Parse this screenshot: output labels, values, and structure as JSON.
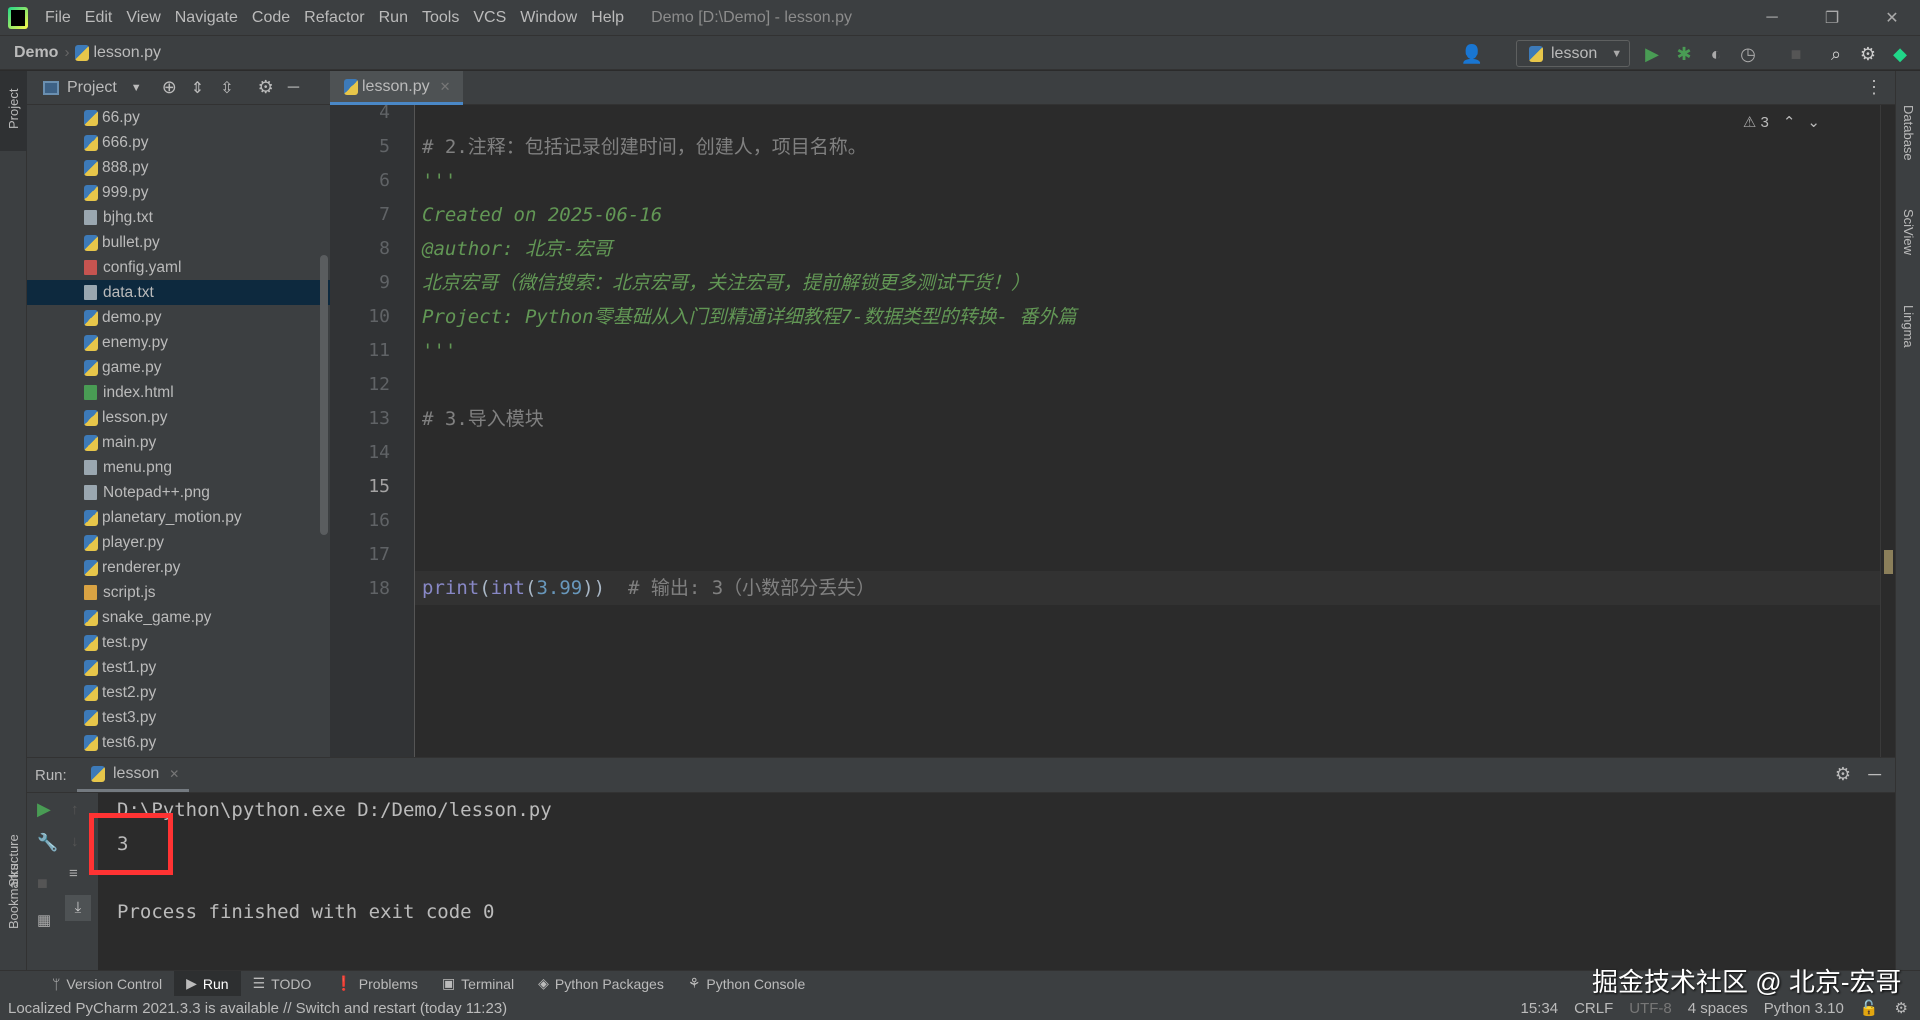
{
  "app": {
    "menu": [
      "File",
      "Edit",
      "View",
      "Navigate",
      "Code",
      "Refactor",
      "Run",
      "Tools",
      "VCS",
      "Window",
      "Help"
    ],
    "window_title": "Demo [D:\\Demo] - lesson.py"
  },
  "navbar": {
    "project": "Demo",
    "file": "lesson.py",
    "run_config": "lesson"
  },
  "project_panel": {
    "title": "Project",
    "files": [
      {
        "name": "66.py",
        "type": "py"
      },
      {
        "name": "666.py",
        "type": "py"
      },
      {
        "name": "888.py",
        "type": "py"
      },
      {
        "name": "999.py",
        "type": "py"
      },
      {
        "name": "bjhg.txt",
        "type": "txt"
      },
      {
        "name": "bullet.py",
        "type": "py"
      },
      {
        "name": "config.yaml",
        "type": "yaml"
      },
      {
        "name": "data.txt",
        "type": "txt",
        "selected": true
      },
      {
        "name": "demo.py",
        "type": "py"
      },
      {
        "name": "enemy.py",
        "type": "py"
      },
      {
        "name": "game.py",
        "type": "py"
      },
      {
        "name": "index.html",
        "type": "html"
      },
      {
        "name": "lesson.py",
        "type": "py"
      },
      {
        "name": "main.py",
        "type": "py"
      },
      {
        "name": "menu.png",
        "type": "png"
      },
      {
        "name": "Notepad++.png",
        "type": "png"
      },
      {
        "name": "planetary_motion.py",
        "type": "py"
      },
      {
        "name": "player.py",
        "type": "py"
      },
      {
        "name": "renderer.py",
        "type": "py"
      },
      {
        "name": "script.js",
        "type": "js"
      },
      {
        "name": "snake_game.py",
        "type": "py"
      },
      {
        "name": "test.py",
        "type": "py"
      },
      {
        "name": "test1.py",
        "type": "py"
      },
      {
        "name": "test2.py",
        "type": "py"
      },
      {
        "name": "test3.py",
        "type": "py"
      },
      {
        "name": "test6.py",
        "type": "py"
      }
    ]
  },
  "editor": {
    "tab": "lesson.py",
    "warnings": "3",
    "current_line": 15,
    "line_numbers": [
      "4",
      "5",
      "6",
      "7",
      "8",
      "9",
      "10",
      "11",
      "12",
      "13",
      "14",
      "15",
      "16",
      "17",
      "18"
    ],
    "lines": {
      "l5": "# 2.注释：包括记录创建时间，创建人，项目名称。",
      "l6": "'''",
      "l7": "Created on 2025-06-16",
      "l8": "@author: 北京-宏哥",
      "l9": "北京宏哥（微信搜索：北京宏哥，关注宏哥，提前解锁更多测试干货！）",
      "l10": "Project: Python零基础从入门到精通详细教程7-数据类型的转换- 番外篇",
      "l11": "'''",
      "l13": "# 3.导入模块",
      "l15_fn": "print",
      "l15_p1": "(",
      "l15_fn2": "int",
      "l15_p2": "(",
      "l15_num": "3.99",
      "l15_p3": "))",
      "l15_cmt": "  # 输出: 3（小数部分丢失）"
    }
  },
  "run_panel": {
    "label": "Run:",
    "tab": "lesson",
    "output": [
      "D:\\Python\\python.exe D:/Demo/lesson.py",
      "3",
      "",
      "Process finished with exit code 0"
    ],
    "highlight_color": "#ff3333"
  },
  "side_labels": {
    "left": [
      "Project",
      "Structure",
      "Bookmarks"
    ],
    "right": [
      "Database",
      "SciView",
      "Lingma"
    ]
  },
  "bottom_tabs": [
    "Version Control",
    "Run",
    "TODO",
    "Problems",
    "Terminal",
    "Python Packages",
    "Python Console"
  ],
  "status": {
    "message": "Localized PyCharm 2021.3.3 is available // Switch and restart (today 11:23)",
    "position": "15:34",
    "line_sep": "CRLF",
    "encoding": "UTF-8",
    "indent": "4 spaces",
    "interpreter": "Python 3.10"
  },
  "watermark": "掘金技术社区 @ 北京-宏哥"
}
